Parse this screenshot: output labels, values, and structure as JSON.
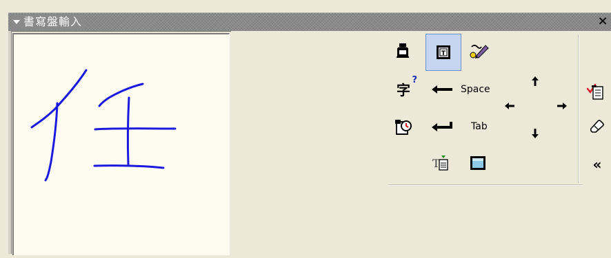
{
  "title": "書寫盤輸入",
  "close_label": "×",
  "tools": {
    "space_label": "Space",
    "tab_label": "Tab",
    "collapse_label": "«",
    "char_lookup_label": "字"
  },
  "icons": [
    "ink-bottle-icon",
    "text-mode-icon",
    "pen-icon",
    "character-lookup-icon",
    "backspace-icon",
    "arrow-up-icon",
    "arrow-left-icon",
    "arrow-right-icon",
    "arrow-down-icon",
    "correction-list-icon",
    "eraser-icon",
    "settings-icon",
    "enter-icon",
    "insert-text-icon",
    "full-screen-pad-icon",
    "collapse-icon"
  ]
}
